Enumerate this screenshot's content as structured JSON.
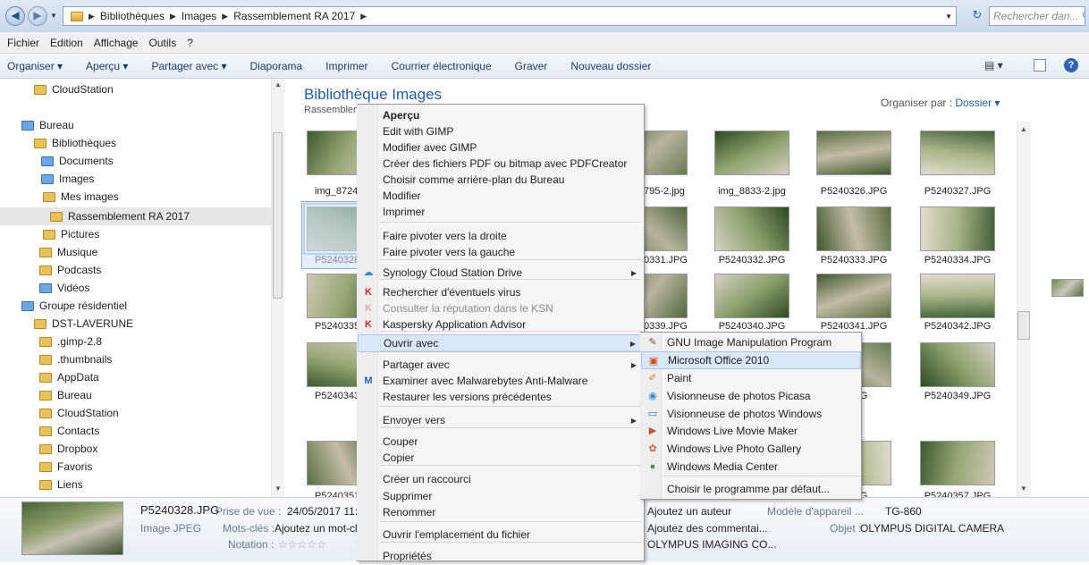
{
  "address": {
    "segments": [
      "Bibliothèques",
      "Images",
      "Rassemblement RA 2017"
    ]
  },
  "search": {
    "placeholder": "Rechercher dan..."
  },
  "menubar": [
    "Fichier",
    "Edition",
    "Affichage",
    "Outils",
    "?"
  ],
  "toolbar": [
    "Organiser ▾",
    "Aperçu ▾",
    "Partager avec ▾",
    "Diaporama",
    "Imprimer",
    "Courrier électronique",
    "Graver",
    "Nouveau dossier"
  ],
  "tree": [
    {
      "label": "CloudStation",
      "icon": "cloud-folder-icon"
    },
    {
      "label": "Bureau",
      "icon": "desktop-icon"
    },
    {
      "label": "Bibliothèques",
      "icon": "libraries-icon"
    },
    {
      "label": "Documents",
      "icon": "documents-icon"
    },
    {
      "label": "Images",
      "icon": "images-icon"
    },
    {
      "label": "Mes images",
      "icon": "folder-icon"
    },
    {
      "label": "Rassemblement RA 2017",
      "icon": "folder-icon"
    },
    {
      "label": "Pictures",
      "icon": "folder-icon"
    },
    {
      "label": "Musique",
      "icon": "music-icon"
    },
    {
      "label": "Podcasts",
      "icon": "folder-icon"
    },
    {
      "label": "Vidéos",
      "icon": "videos-icon"
    },
    {
      "label": "Groupe résidentiel",
      "icon": "homegroup-icon"
    },
    {
      "label": "DST-LAVERUNE",
      "icon": "user-folder-icon"
    },
    {
      "label": ".gimp-2.8",
      "icon": "folder-icon"
    },
    {
      "label": ".thumbnails",
      "icon": "folder-icon"
    },
    {
      "label": "AppData",
      "icon": "folder-icon"
    },
    {
      "label": "Bureau",
      "icon": "folder-icon"
    },
    {
      "label": "CloudStation",
      "icon": "folder-icon"
    },
    {
      "label": "Contacts",
      "icon": "folder-icon"
    },
    {
      "label": "Dropbox",
      "icon": "folder-icon"
    },
    {
      "label": "Favoris",
      "icon": "folder-icon"
    },
    {
      "label": "Liens",
      "icon": "folder-icon"
    }
  ],
  "library": {
    "title": "Bibliothèque Images",
    "subtitle": "Rassemblem",
    "organize_label": "Organiser par :",
    "organize_value": "Dossier ▾"
  },
  "files": [
    {
      "name": "img_8724",
      "col": 0,
      "row": 0
    },
    {
      "name": "795-2.jpg",
      "col": 3,
      "row": 0
    },
    {
      "name": "img_8833-2.jpg",
      "col": 4,
      "row": 0
    },
    {
      "name": "P5240326.JPG",
      "col": 5,
      "row": 0
    },
    {
      "name": "P5240327.JPG",
      "col": 6,
      "row": 0
    },
    {
      "name": "P5240328",
      "col": 0,
      "row": 1
    },
    {
      "name": "0331.JPG",
      "col": 3,
      "row": 1
    },
    {
      "name": "P5240332.JPG",
      "col": 4,
      "row": 1
    },
    {
      "name": "P5240333.JPG",
      "col": 5,
      "row": 1
    },
    {
      "name": "P5240334.JPG",
      "col": 6,
      "row": 1
    },
    {
      "name": "P5240335",
      "col": 0,
      "row": 2
    },
    {
      "name": "0339.JPG",
      "col": 3,
      "row": 2
    },
    {
      "name": "P5240340.JPG",
      "col": 4,
      "row": 2
    },
    {
      "name": "P5240341.JPG",
      "col": 5,
      "row": 2
    },
    {
      "name": "P5240342.JPG",
      "col": 6,
      "row": 2
    },
    {
      "name": "P5240343",
      "col": 0,
      "row": 3
    },
    {
      "name": "8.JPG",
      "col": 5,
      "row": 3
    },
    {
      "name": "P5240349.JPG",
      "col": 6,
      "row": 3
    },
    {
      "name": "P5240351",
      "col": 0,
      "row": 4
    },
    {
      "name": "5.JPG",
      "col": 5,
      "row": 4
    },
    {
      "name": "P5240357.JPG",
      "col": 6,
      "row": 4
    }
  ],
  "details": {
    "filename": "P5240328.JPG",
    "filetype": "Image JPEG",
    "date_label": "Prise de vue :",
    "date_value": "24/05/2017 11:08",
    "keywords_label": "Mots-clés :",
    "keywords_value": "Ajoutez un mot-cl",
    "rating_label": "Notation :",
    "rating_value": "☆☆☆☆☆",
    "author": "Ajoutez un auteur",
    "comments": "Ajoutez des commentai...",
    "maker": "OLYMPUS IMAGING CO...",
    "model_label": "Modèle d'appareil ...",
    "model_value": "TG-860",
    "object_label": "Objet :",
    "object_value": "OLYMPUS DIGITAL CAMERA"
  },
  "context_menu": [
    {
      "label": "Aperçu",
      "bold": true
    },
    {
      "label": "Edit with GIMP"
    },
    {
      "label": "Modifier avec GIMP"
    },
    {
      "label": "Créer des fichiers PDF ou bitmap avec PDFCreator"
    },
    {
      "label": "Choisir comme arrière-plan du Bureau"
    },
    {
      "label": "Modifier"
    },
    {
      "label": "Imprimer"
    },
    {
      "sep": true
    },
    {
      "label": "Faire pivoter vers la droite"
    },
    {
      "label": "Faire pivoter vers la gauche"
    },
    {
      "sep": true
    },
    {
      "label": "Synology Cloud Station Drive",
      "icon": "synology-icon",
      "submenu": true
    },
    {
      "sep": true
    },
    {
      "label": "Rechercher d'éventuels virus",
      "icon": "kaspersky-icon"
    },
    {
      "label": "Consulter la réputation dans le KSN",
      "icon": "kaspersky-icon",
      "disabled": true
    },
    {
      "label": "Kaspersky Application Advisor",
      "icon": "kaspersky-icon"
    },
    {
      "sep": true
    },
    {
      "label": "Ouvrir avec",
      "submenu": true,
      "highlight": true
    },
    {
      "sep": true
    },
    {
      "label": "Partager avec",
      "submenu": true
    },
    {
      "label": "Examiner avec Malwarebytes Anti-Malware",
      "icon": "malwarebytes-icon"
    },
    {
      "label": "Restaurer les versions précédentes"
    },
    {
      "sep": true
    },
    {
      "label": "Envoyer vers",
      "submenu": true
    },
    {
      "sep": true
    },
    {
      "label": "Couper"
    },
    {
      "label": "Copier"
    },
    {
      "sep": true
    },
    {
      "label": "Créer un raccourci"
    },
    {
      "label": "Supprimer"
    },
    {
      "label": "Renommer"
    },
    {
      "sep": true
    },
    {
      "label": "Ouvrir l'emplacement du fichier"
    },
    {
      "sep": true
    },
    {
      "label": "Propriétés"
    }
  ],
  "open_with": [
    {
      "label": "GNU Image Manipulation Program",
      "icon": "gimp-icon"
    },
    {
      "label": "Microsoft Office 2010",
      "icon": "office-icon",
      "highlight": true
    },
    {
      "label": "Paint",
      "icon": "paint-icon"
    },
    {
      "label": "Visionneuse de photos Picasa",
      "icon": "picasa-icon"
    },
    {
      "label": "Visionneuse de photos Windows",
      "icon": "photo-viewer-icon"
    },
    {
      "label": "Windows Live Movie Maker",
      "icon": "movie-maker-icon"
    },
    {
      "label": "Windows Live Photo Gallery",
      "icon": "photo-gallery-icon"
    },
    {
      "label": "Windows Media Center",
      "icon": "media-center-icon"
    },
    {
      "sep": true
    },
    {
      "label": "Choisir le programme par défaut..."
    }
  ],
  "colors": {
    "accent": "#1f5ea8",
    "highlight": "#d9e7f7"
  }
}
